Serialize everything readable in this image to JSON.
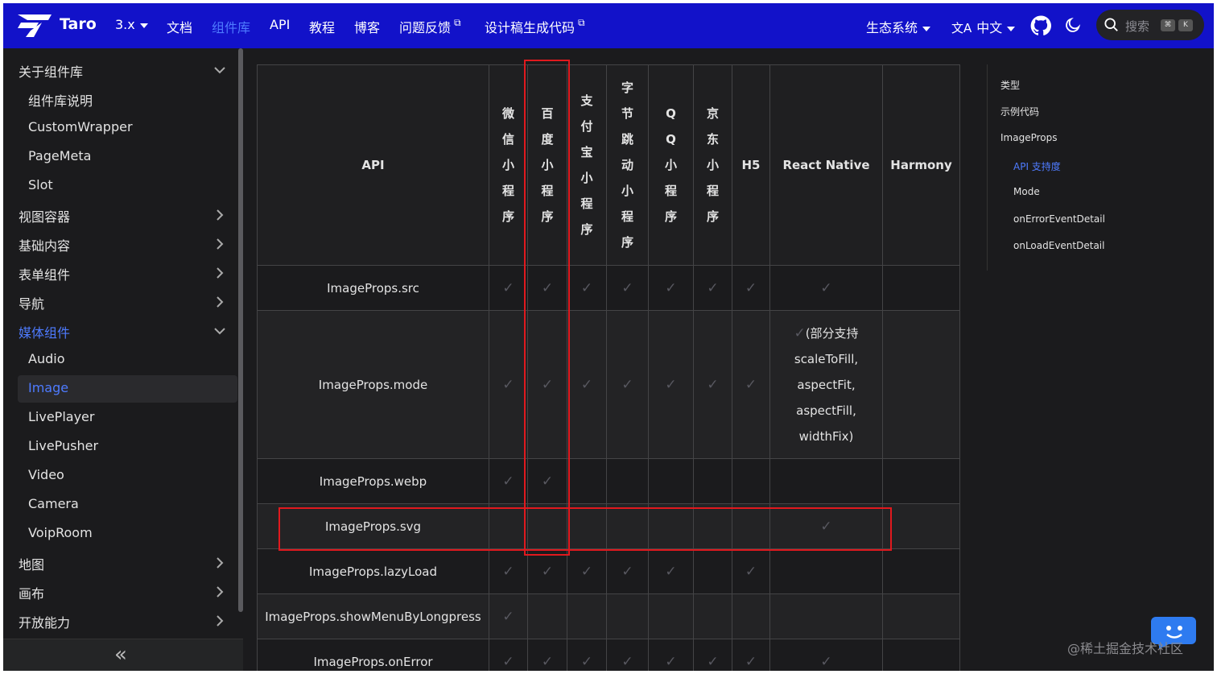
{
  "navbar": {
    "brand": "Taro",
    "version": "3.x",
    "items": [
      "文档",
      "组件库",
      "API",
      "教程",
      "博客",
      "问题反馈",
      "设计稿生成代码"
    ],
    "right_items": [
      "生态系统",
      "中文"
    ],
    "search_placeholder": "搜索",
    "search_keys": [
      "⌘",
      "K"
    ],
    "colors": {
      "bar": "#1212c9",
      "active": "#4e7bff"
    }
  },
  "sidebar": {
    "items": [
      {
        "label": "关于组件库",
        "level": "top",
        "expanded": true
      },
      {
        "label": "组件库说明",
        "level": "sub"
      },
      {
        "label": "CustomWrapper",
        "level": "sub"
      },
      {
        "label": "PageMeta",
        "level": "sub"
      },
      {
        "label": "Slot",
        "level": "sub"
      },
      {
        "label": "视图容器",
        "level": "top"
      },
      {
        "label": "基础内容",
        "level": "top"
      },
      {
        "label": "表单组件",
        "level": "top"
      },
      {
        "label": "导航",
        "level": "top"
      },
      {
        "label": "媒体组件",
        "level": "top",
        "expanded": true,
        "active": true
      },
      {
        "label": "Audio",
        "level": "sub"
      },
      {
        "label": "Image",
        "level": "sub",
        "active": true
      },
      {
        "label": "LivePlayer",
        "level": "sub"
      },
      {
        "label": "LivePusher",
        "level": "sub"
      },
      {
        "label": "Video",
        "level": "sub"
      },
      {
        "label": "Camera",
        "level": "sub"
      },
      {
        "label": "VoipRoom",
        "level": "sub"
      },
      {
        "label": "地图",
        "level": "top"
      },
      {
        "label": "画布",
        "level": "top"
      },
      {
        "label": "开放能力",
        "level": "top"
      }
    ],
    "collapse_label": "«"
  },
  "table": {
    "headers": [
      "API",
      "微信小程序",
      "百度小程序",
      "支付宝小程序",
      "字节跳动小程序",
      "QQ小程序",
      "京东小程序",
      "H5",
      "React Native",
      "Harmony"
    ],
    "check": "✓",
    "rows": [
      {
        "api": "ImageProps.src",
        "support": [
          true,
          true,
          true,
          true,
          true,
          true,
          true,
          true,
          false
        ]
      },
      {
        "api": "ImageProps.mode",
        "support": [
          true,
          true,
          true,
          true,
          true,
          true,
          true,
          "note",
          false
        ],
        "rn_note": [
          "(部分支持",
          "scaleToFill,",
          "aspectFit,",
          "aspectFill,",
          "widthFix)"
        ]
      },
      {
        "api": "ImageProps.webp",
        "support": [
          true,
          true,
          false,
          false,
          false,
          false,
          false,
          false,
          false
        ]
      },
      {
        "api": "ImageProps.svg",
        "support": [
          false,
          false,
          false,
          false,
          false,
          false,
          false,
          true,
          false
        ]
      },
      {
        "api": "ImageProps.lazyLoad",
        "support": [
          true,
          true,
          true,
          true,
          true,
          false,
          true,
          false,
          false
        ]
      },
      {
        "api": "ImageProps.showMenuByLongpress",
        "support": [
          true,
          false,
          false,
          false,
          false,
          false,
          false,
          false,
          false
        ]
      },
      {
        "api": "ImageProps.onError",
        "support": [
          true,
          true,
          true,
          true,
          true,
          true,
          true,
          true,
          false
        ]
      }
    ]
  },
  "toc": {
    "items": [
      {
        "label": "类型",
        "indent": false
      },
      {
        "label": "示例代码",
        "indent": false
      },
      {
        "label": "ImageProps",
        "indent": false
      },
      {
        "label": "API 支持度",
        "indent": true,
        "active": true
      },
      {
        "label": "Mode",
        "indent": true
      },
      {
        "label": "onErrorEventDetail",
        "indent": true
      },
      {
        "label": "onLoadEventDetail",
        "indent": true
      }
    ]
  },
  "watermark": "@稀土掘金技术社区"
}
